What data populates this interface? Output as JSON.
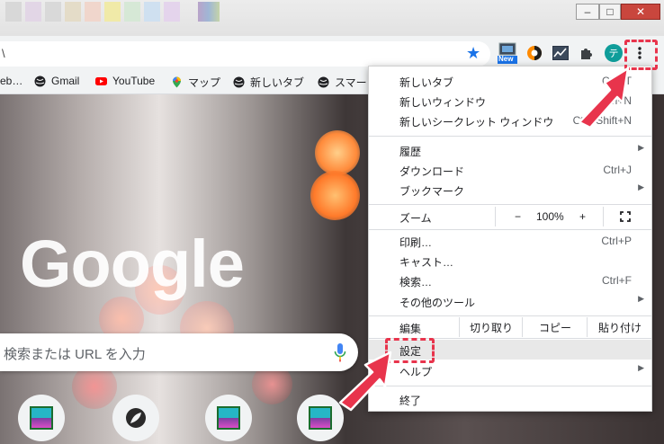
{
  "toolbar": {
    "omnibox_text": "\\",
    "new_badge": "New",
    "profile_initial": "テ"
  },
  "bookmarks": [
    {
      "label": "eb…",
      "icon": "bookmark-stub-icon"
    },
    {
      "label": "Gmail",
      "icon": "globe-icon"
    },
    {
      "label": "YouTube",
      "icon": "youtube-icon"
    },
    {
      "label": "マップ",
      "icon": "maps-pin-icon"
    },
    {
      "label": "新しいタブ",
      "icon": "globe-icon"
    },
    {
      "label": "スマー",
      "icon": "globe-icon"
    }
  ],
  "ntp": {
    "logo": "Google",
    "search_placeholder": "検索または URL を入力"
  },
  "menu": {
    "new_tab": {
      "label": "新しいタブ",
      "shortcut": "Ctrl+T"
    },
    "new_window": {
      "label": "新しいウィンドウ",
      "shortcut": "Ctrl+N"
    },
    "new_incognito": {
      "label": "新しいシークレット ウィンドウ",
      "shortcut": "Ctrl+Shift+N"
    },
    "history": {
      "label": "履歴"
    },
    "downloads": {
      "label": "ダウンロード",
      "shortcut": "Ctrl+J"
    },
    "bookmarks": {
      "label": "ブックマーク"
    },
    "zoom": {
      "label": "ズーム",
      "minus": "−",
      "value": "100%",
      "plus": "+"
    },
    "print": {
      "label": "印刷…",
      "shortcut": "Ctrl+P"
    },
    "cast": {
      "label": "キャスト…"
    },
    "find": {
      "label": "検索…",
      "shortcut": "Ctrl+F"
    },
    "more_tools": {
      "label": "その他のツール"
    },
    "edit": {
      "label": "編集",
      "cut": "切り取り",
      "copy": "コピー",
      "paste": "貼り付け"
    },
    "settings": {
      "label": "設定"
    },
    "help": {
      "label": "ヘルプ"
    },
    "exit": {
      "label": "終了"
    }
  },
  "colors": {
    "highlight": "#e8344c",
    "accent": "#1a73e8"
  }
}
